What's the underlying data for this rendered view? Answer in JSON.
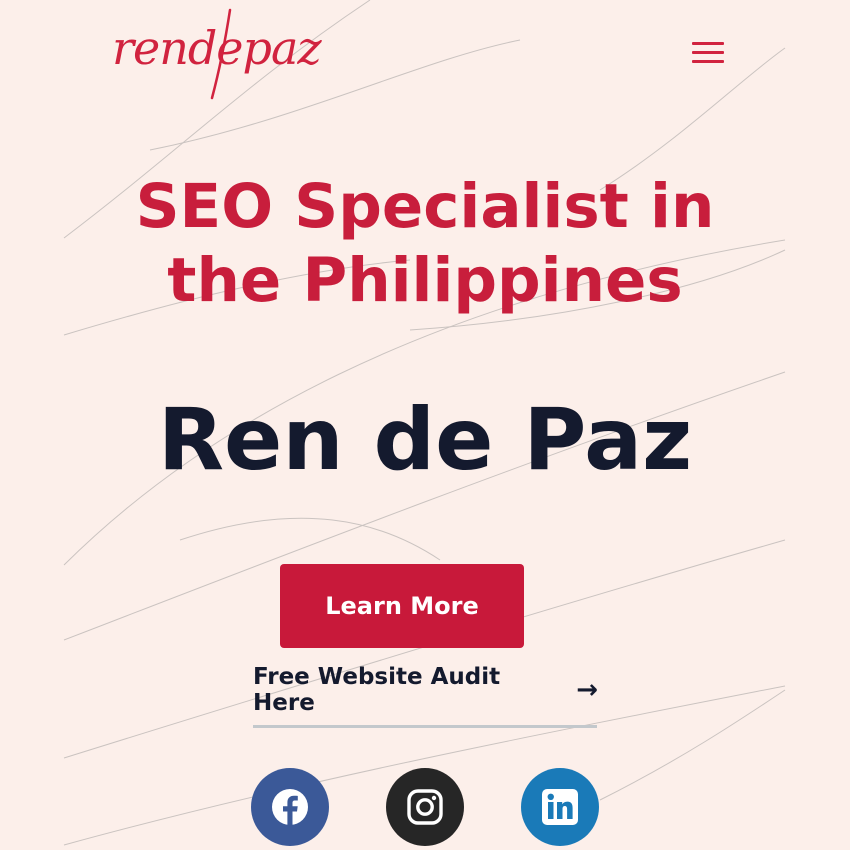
{
  "header": {
    "logo_text": "rendepaz",
    "menu_icon": "hamburger-menu-icon"
  },
  "hero": {
    "headline_line1": "SEO Specialist in",
    "headline_line2": "the Philippines",
    "name": "Ren de Paz",
    "cta_label": "Learn More",
    "audit_link_label": "Free Website Audit Here",
    "audit_arrow": "→"
  },
  "social": [
    {
      "name": "facebook",
      "icon": "facebook-icon",
      "color": "#3b5998"
    },
    {
      "name": "instagram",
      "icon": "instagram-icon",
      "color": "#262626"
    },
    {
      "name": "linkedin",
      "icon": "linkedin-icon",
      "color": "#1a7ab8"
    }
  ],
  "colors": {
    "background": "#fcefea",
    "accent": "#c8193a",
    "heading_dark": "#141a2e"
  }
}
